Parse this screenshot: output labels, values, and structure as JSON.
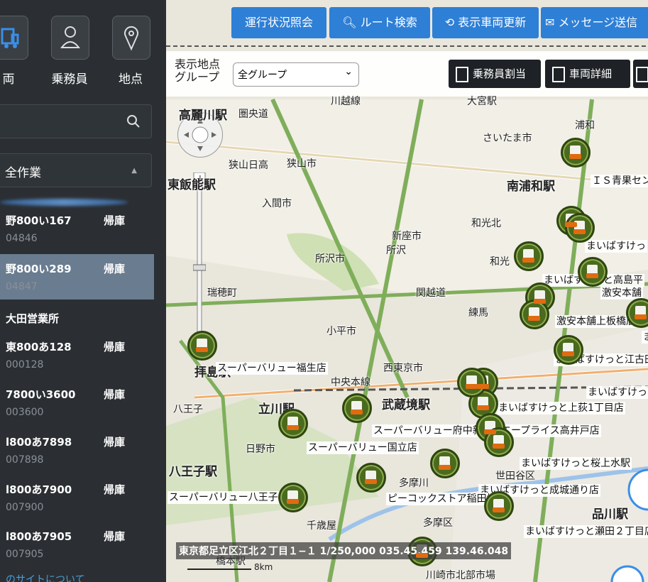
{
  "sidebar": {
    "nav": [
      {
        "label": "両",
        "icon": "truck-icon"
      },
      {
        "label": "乗務員",
        "icon": "person-icon"
      },
      {
        "label": "地点",
        "icon": "location-icon"
      }
    ],
    "search_placeholder": "",
    "filter_label": "全作業",
    "vehicles_top": [
      {
        "plate": "野800い167",
        "id": "04846",
        "status": "帰庫"
      },
      {
        "plate": "野800い289",
        "id": "04847",
        "status": "帰庫",
        "selected": true
      }
    ],
    "office": "大田営業所",
    "vehicles_bottom": [
      {
        "plate": "東800あ128",
        "id": "000128",
        "status": "帰庫"
      },
      {
        "plate": "7800い3600",
        "id": "003600",
        "status": "帰庫"
      },
      {
        "plate": "l800あ7898",
        "id": "007898",
        "status": "帰庫"
      },
      {
        "plate": "l800あ7900",
        "id": "007900",
        "status": "帰庫"
      },
      {
        "plate": "l800あ7905",
        "id": "007905",
        "status": "帰庫"
      }
    ],
    "footer_link": "のサイトについて"
  },
  "toolbar": {
    "operation_status": "運行状況照会",
    "route_search": "ルート検索",
    "refresh": "表示車両更新",
    "send_message": "メッセージ送信"
  },
  "groupbar": {
    "label_line1": "表示地点",
    "label_line2": "グループ",
    "select_value": "全グループ",
    "crew_assign": "乗務員割当",
    "vehicle_detail": "車両詳細"
  },
  "map": {
    "places": [
      {
        "text": "高麗川駅"
      },
      {
        "text": "圏央道"
      },
      {
        "text": "狭山日高"
      },
      {
        "text": "狭山市"
      },
      {
        "text": "東飯能駅"
      },
      {
        "text": "入間市"
      },
      {
        "text": "所沢市"
      },
      {
        "text": "新座市"
      },
      {
        "text": "所沢"
      },
      {
        "text": "和光北"
      },
      {
        "text": "和光"
      },
      {
        "text": "南浦和駅"
      },
      {
        "text": "さいたま市"
      },
      {
        "text": "浦和"
      },
      {
        "text": "川越線"
      },
      {
        "text": "大宮駅"
      },
      {
        "text": "関越道"
      },
      {
        "text": "練馬"
      },
      {
        "text": "瑞穂町"
      },
      {
        "text": "小平市"
      },
      {
        "text": "西東京市"
      },
      {
        "text": "拝島駅"
      },
      {
        "text": "中央本線"
      },
      {
        "text": "武蔵境駅"
      },
      {
        "text": "八王子"
      },
      {
        "text": "立川駅"
      },
      {
        "text": "日野市"
      },
      {
        "text": "八王子駅"
      },
      {
        "text": "多摩川"
      },
      {
        "text": "多摩区"
      },
      {
        "text": "千歳屋"
      },
      {
        "text": "世田谷区"
      },
      {
        "text": "品川駅"
      },
      {
        "text": "川崎市北部市場"
      },
      {
        "text": "橋本駅"
      }
    ],
    "stores": [
      {
        "text": "ＩＳ青果セン"
      },
      {
        "text": "まいばすけっ"
      },
      {
        "text": "まいばすけっと高島平"
      },
      {
        "text": "激安本舗"
      },
      {
        "text": "激安本舗上板橋店"
      },
      {
        "text": "まい"
      },
      {
        "text": "まいばすけっと江古田"
      },
      {
        "text": "スーパーバリュー福生店"
      },
      {
        "text": "まいばすけっ"
      },
      {
        "text": "まいばすけっと上荻1丁目店"
      },
      {
        "text": "スーパーバリュー府中新町店"
      },
      {
        "text": "エープライス高井戸店"
      },
      {
        "text": "まいばすけっと桜上水駅"
      },
      {
        "text": "スーパーバリュー国立店"
      },
      {
        "text": "まいばすけっと成城通り店"
      },
      {
        "text": "スーパーバリュー八王子"
      },
      {
        "text": "ピーコックストア稲田堤店"
      },
      {
        "text": "まいばすけっと瀬田２丁目店"
      }
    ],
    "status_line": "東京都足立区江北２丁目１−１ 1/250,000 035.45.459 139.46.048",
    "scale_label": "8km"
  }
}
